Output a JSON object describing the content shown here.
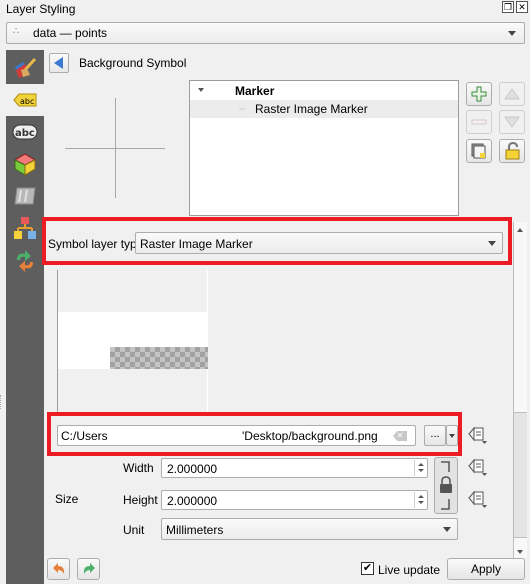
{
  "window": {
    "title": "Layer Styling",
    "float_icon": "float-window-icon",
    "close_icon": "close-icon"
  },
  "layer_selector": {
    "value": "data — points",
    "icon": "point-layer-icon"
  },
  "sidebar": {
    "items": [
      {
        "name": "symbology",
        "icon": "paintbrush-icon",
        "active": false
      },
      {
        "name": "labels",
        "icon": "label-tag-icon",
        "active": true
      },
      {
        "name": "masks",
        "icon": "abc-mask-icon",
        "active": false
      },
      {
        "name": "3d-view",
        "icon": "cube-3d-icon",
        "active": false
      },
      {
        "name": "rendering",
        "icon": "diagram-icon",
        "active": false
      },
      {
        "name": "fields",
        "icon": "hierarchy-icon",
        "active": false
      },
      {
        "name": "history",
        "icon": "history-arrows-icon",
        "active": false
      }
    ]
  },
  "header": {
    "back_icon": "back-arrow-icon",
    "title": "Background Symbol"
  },
  "symbol_tree": {
    "root": "Marker",
    "children": [
      "Raster Image Marker"
    ],
    "selected": "Raster Image Marker"
  },
  "tree_buttons": {
    "add": "add-layer-icon",
    "remove": "remove-layer-icon",
    "move_up": "move-up-icon",
    "move_down": "move-down-icon",
    "duplicate": "duplicate-layer-icon",
    "lock": "lock-color-icon"
  },
  "symbol_layer_type": {
    "label": "Symbol layer type",
    "value": "Raster Image Marker"
  },
  "file": {
    "path_start": "C:/Users",
    "path_end": "'Desktop/background.png",
    "browse_label": "..."
  },
  "size": {
    "label": "Size",
    "width_label": "Width",
    "width_value": "2.000000",
    "height_label": "Height",
    "height_value": "2.000000",
    "unit_label": "Unit",
    "unit_value": "Millimeters"
  },
  "footer": {
    "live_update_label": "Live update",
    "live_update_checked": "✔",
    "apply_label": "Apply"
  },
  "colors": {
    "highlight": "#ed1c24",
    "sidebar_bg": "#5e5e5e",
    "panel_bg": "#f0f0f0"
  }
}
